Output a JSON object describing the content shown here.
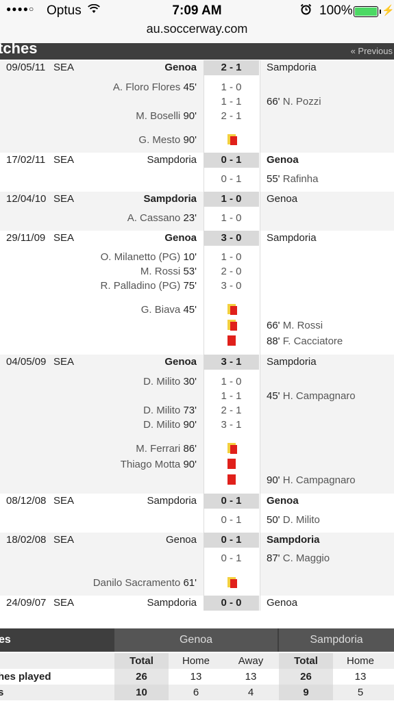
{
  "status_bar": {
    "signal": "●●●●○",
    "carrier": "Optus",
    "wifi": "wifi-icon",
    "time": "7:09 AM",
    "alarm": "alarm-icon",
    "battery_pct": "100%",
    "battery_level": 1.0
  },
  "browser": {
    "url": "au.soccerway.com"
  },
  "section": {
    "title": "tches",
    "prev_link": "« Previous"
  },
  "matches": [
    {
      "date": "09/05/11",
      "comp": "SEA",
      "home": "Genoa",
      "score": "2 - 1",
      "away": "Sampdoria",
      "winner": "home",
      "events": [
        {
          "left": "A. Floro Flores",
          "lmin": "45'",
          "center": "1 - 0",
          "right": "",
          "rmin": ""
        },
        {
          "left": "",
          "lmin": "",
          "center": "1 - 1",
          "right": "N. Pozzi",
          "rmin": "66'"
        },
        {
          "left": "M. Boselli",
          "lmin": "90'",
          "center": "2 - 1",
          "right": "",
          "rmin": ""
        },
        {
          "gap": true
        },
        {
          "left": "G. Mesto",
          "lmin": "90'",
          "card": "yellow-red",
          "right": "",
          "rmin": ""
        }
      ]
    },
    {
      "date": "17/02/11",
      "comp": "SEA",
      "home": "Sampdoria",
      "score": "0 - 1",
      "away": "Genoa",
      "winner": "away",
      "events": [
        {
          "left": "",
          "lmin": "",
          "center": "0 - 1",
          "right": "Rafinha",
          "rmin": "55'"
        }
      ]
    },
    {
      "date": "12/04/10",
      "comp": "SEA",
      "home": "Sampdoria",
      "score": "1 - 0",
      "away": "Genoa",
      "winner": "home",
      "events": [
        {
          "left": "A. Cassano",
          "lmin": "23'",
          "center": "1 - 0",
          "right": "",
          "rmin": ""
        }
      ]
    },
    {
      "date": "29/11/09",
      "comp": "SEA",
      "home": "Genoa",
      "score": "3 - 0",
      "away": "Sampdoria",
      "winner": "home",
      "events": [
        {
          "left": "O. Milanetto (PG)",
          "lmin": "10'",
          "center": "1 - 0",
          "right": "",
          "rmin": ""
        },
        {
          "left": "M. Rossi",
          "lmin": "53'",
          "center": "2 - 0",
          "right": "",
          "rmin": ""
        },
        {
          "left": "R. Palladino (PG)",
          "lmin": "75'",
          "center": "3 - 0",
          "right": "",
          "rmin": ""
        },
        {
          "gap": true
        },
        {
          "left": "G. Biava",
          "lmin": "45'",
          "card": "yellow-red",
          "right": "",
          "rmin": ""
        },
        {
          "left": "",
          "lmin": "",
          "card": "yellow-red",
          "right": "M. Rossi",
          "rmin": "66'"
        },
        {
          "left": "",
          "lmin": "",
          "card": "red",
          "right": "F. Cacciatore",
          "rmin": "88'"
        }
      ]
    },
    {
      "date": "04/05/09",
      "comp": "SEA",
      "home": "Genoa",
      "score": "3 - 1",
      "away": "Sampdoria",
      "winner": "home",
      "events": [
        {
          "left": "D. Milito",
          "lmin": "30'",
          "center": "1 - 0",
          "right": "",
          "rmin": ""
        },
        {
          "left": "",
          "lmin": "",
          "center": "1 - 1",
          "right": "H. Campagnaro",
          "rmin": "45'"
        },
        {
          "left": "D. Milito",
          "lmin": "73'",
          "center": "2 - 1",
          "right": "",
          "rmin": ""
        },
        {
          "left": "D. Milito",
          "lmin": "90'",
          "center": "3 - 1",
          "right": "",
          "rmin": ""
        },
        {
          "gap": true
        },
        {
          "left": "M. Ferrari",
          "lmin": "86'",
          "card": "yellow-red",
          "right": "",
          "rmin": ""
        },
        {
          "left": "Thiago Motta",
          "lmin": "90'",
          "card": "red",
          "right": "",
          "rmin": ""
        },
        {
          "left": "",
          "lmin": "",
          "card": "red",
          "right": "H. Campagnaro",
          "rmin": "90'"
        }
      ]
    },
    {
      "date": "08/12/08",
      "comp": "SEA",
      "home": "Sampdoria",
      "score": "0 - 1",
      "away": "Genoa",
      "winner": "away",
      "events": [
        {
          "left": "",
          "lmin": "",
          "center": "0 - 1",
          "right": "D. Milito",
          "rmin": "50'"
        }
      ]
    },
    {
      "date": "18/02/08",
      "comp": "SEA",
      "home": "Genoa",
      "score": "0 - 1",
      "away": "Sampdoria",
      "winner": "away",
      "events": [
        {
          "left": "",
          "lmin": "",
          "center": "0 - 1",
          "right": "C. Maggio",
          "rmin": "87'"
        },
        {
          "gap": true
        },
        {
          "left": "Danilo Sacramento",
          "lmin": "61'",
          "card": "yellow-red",
          "right": "",
          "rmin": ""
        }
      ]
    },
    {
      "date": "24/09/07",
      "comp": "SEA",
      "home": "Sampdoria",
      "score": "0 - 0",
      "away": "Genoa",
      "winner": "none",
      "events": []
    }
  ],
  "stats": {
    "title": "es",
    "team1": "Genoa",
    "team2": "Sampdoria",
    "columns": [
      "Total",
      "Home",
      "Away",
      "Total",
      "Home"
    ],
    "rows": [
      {
        "label": "hes played",
        "values": [
          "26",
          "13",
          "13",
          "26",
          "13"
        ]
      },
      {
        "label": "s",
        "values": [
          "10",
          "6",
          "4",
          "9",
          "5"
        ]
      }
    ]
  }
}
